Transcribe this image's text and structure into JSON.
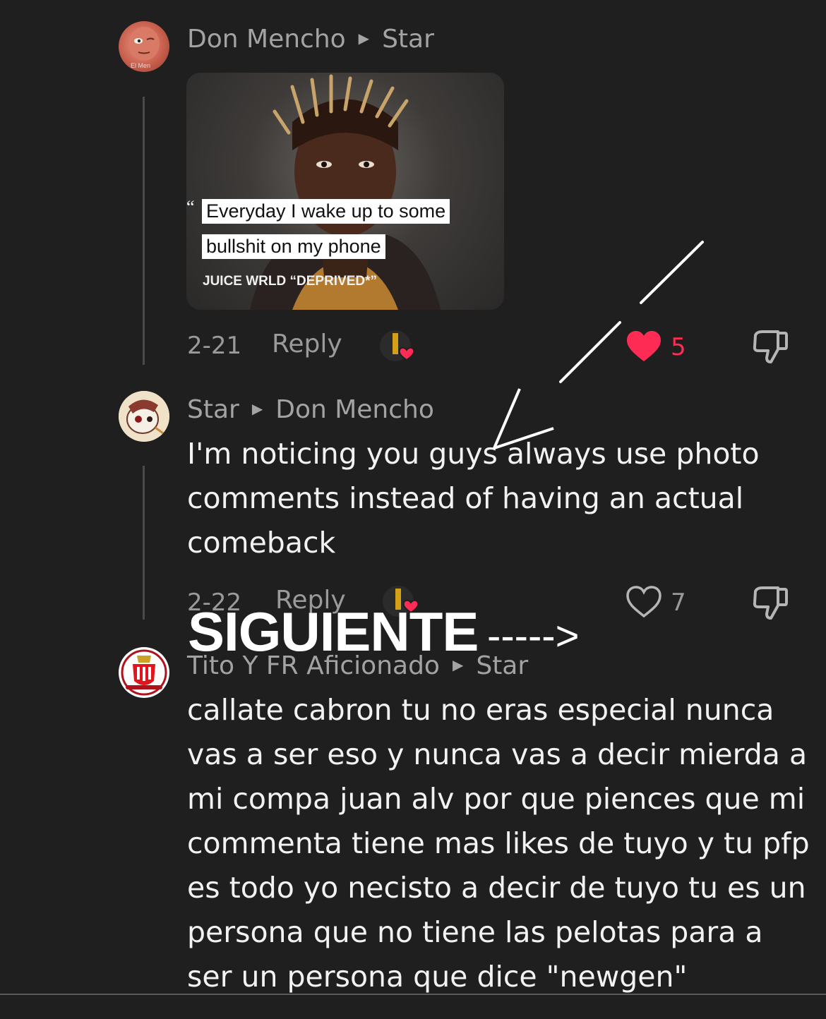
{
  "comments": [
    {
      "author": "Don Mencho",
      "reply_to": "Star",
      "avatar_caption": "El Men",
      "photo": {
        "quote_line1": "Everyday I wake up to some",
        "quote_line2": "bullshit on my phone",
        "caption": "JUICE WRLD “DEPRIVED*”"
      },
      "date": "2-21",
      "reply_label": "Reply",
      "likes": "5",
      "liked": true
    },
    {
      "author": "Star",
      "reply_to": "Don Mencho",
      "text": "I'm noticing you guys always use photo comments instead of having an actual comeback",
      "date": "2-22",
      "reply_label": "Reply",
      "likes": "7",
      "liked": false
    },
    {
      "author": "Tito Y FR Aficionado",
      "reply_to": "Star",
      "text": "callate cabron tu no eras especial nunca vas a ser eso y nunca vas a decir mierda a mi compa juan alv por que piences que mi commenta tiene mas likes de tuyo y tu pfp es todo yo necisto a decir de tuyo tu es un persona que no tiene las pelotas para a ser un persona que dice \"newgen\""
    }
  ],
  "overlay": {
    "text": "SIGUIENTE",
    "arrow": "----->"
  },
  "colors": {
    "background": "#1f1f1f",
    "like_red": "#fe2c55",
    "muted_text": "#a3a3a3"
  }
}
